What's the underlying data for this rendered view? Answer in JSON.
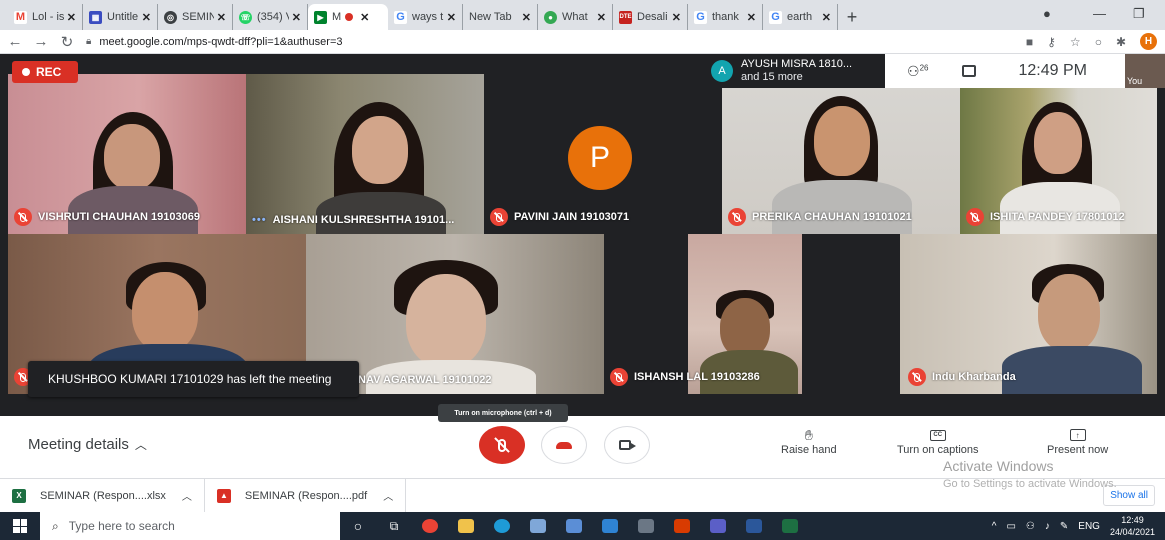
{
  "browser": {
    "tabs": [
      {
        "title": "Lol - is",
        "favicon": "gmail-icon",
        "color": "#ea4335",
        "active": false
      },
      {
        "title": "Untitle",
        "favicon": "sheets-icon",
        "color": "#3a4cc0",
        "active": false
      },
      {
        "title": "SEMIN",
        "favicon": "globe-icon",
        "color": "#3c4043",
        "active": false
      },
      {
        "title": "(354) V",
        "favicon": "whatsapp-icon",
        "color": "#25d366",
        "active": false
      },
      {
        "title": "M",
        "favicon": "meet-icon",
        "color": "#00832d",
        "active": true
      },
      {
        "title": "ways t",
        "favicon": "google-icon",
        "color": "#4285f4",
        "active": false
      },
      {
        "title": "New Tab",
        "favicon": "",
        "color": "#dee1e6",
        "active": false
      },
      {
        "title": "What",
        "favicon": "chrome-icon",
        "color": "#34a853",
        "active": false
      },
      {
        "title": "Desali",
        "favicon": "dte-icon",
        "color": "#c5221f",
        "active": false
      },
      {
        "title": "thank",
        "favicon": "google-icon",
        "color": "#4285f4",
        "active": false
      },
      {
        "title": "earth",
        "favicon": "google-icon",
        "color": "#4285f4",
        "active": false
      }
    ],
    "url": "meet.google.com/mps-qwdt-dff?pli=1&authuser=3",
    "profile_initial": "H"
  },
  "meet": {
    "rec_label": "REC",
    "presenter": {
      "initial": "A",
      "name": "AYUSH MISRA 1810...",
      "more": "and 15 more"
    },
    "people_count": "26",
    "clock": "12:49 PM",
    "self_label": "You",
    "participants": [
      {
        "name": "VISHRUTI CHAUHAN 19103069",
        "muted": true
      },
      {
        "name": "AISHANI KULSHRESHTHA 19101...",
        "muted": false
      },
      {
        "name": "PAVINI JAIN 19103071",
        "muted": true,
        "avatar": "P"
      },
      {
        "name": "PRERIKA CHAUHAN 19101021",
        "muted": true
      },
      {
        "name": "ISHITA PANDEY 17801012",
        "muted": true
      },
      {
        "name": "NAV AGARWAL 19101022",
        "muted": true
      },
      {
        "name": "ISHANSH LAL 19103286",
        "muted": true
      },
      {
        "name": "Indu Kharbanda",
        "muted": true
      }
    ],
    "toast": "KHUSHBOO KUMARI 17101029 has left the meeting",
    "tooltip": "Turn on microphone (ctrl + d)"
  },
  "controls": {
    "meeting_details": "Meeting details",
    "raise_hand": "Raise hand",
    "captions": "Turn on captions",
    "present": "Present now",
    "cc_text": "CC"
  },
  "watermark": {
    "line1": "Activate Windows",
    "line2": "Go to Settings to activate Windows."
  },
  "downloads": {
    "items": [
      {
        "name": "SEMINAR (Respon....xlsx",
        "type": "excel-icon",
        "color": "#1d6f42"
      },
      {
        "name": "SEMINAR (Respon....pdf",
        "type": "pdf-icon",
        "color": "#d93025"
      }
    ],
    "show_all": "Show all"
  },
  "taskbar": {
    "search_placeholder": "Type here to search",
    "language": "ENG",
    "time": "12:49",
    "date": "24/04/2021"
  }
}
